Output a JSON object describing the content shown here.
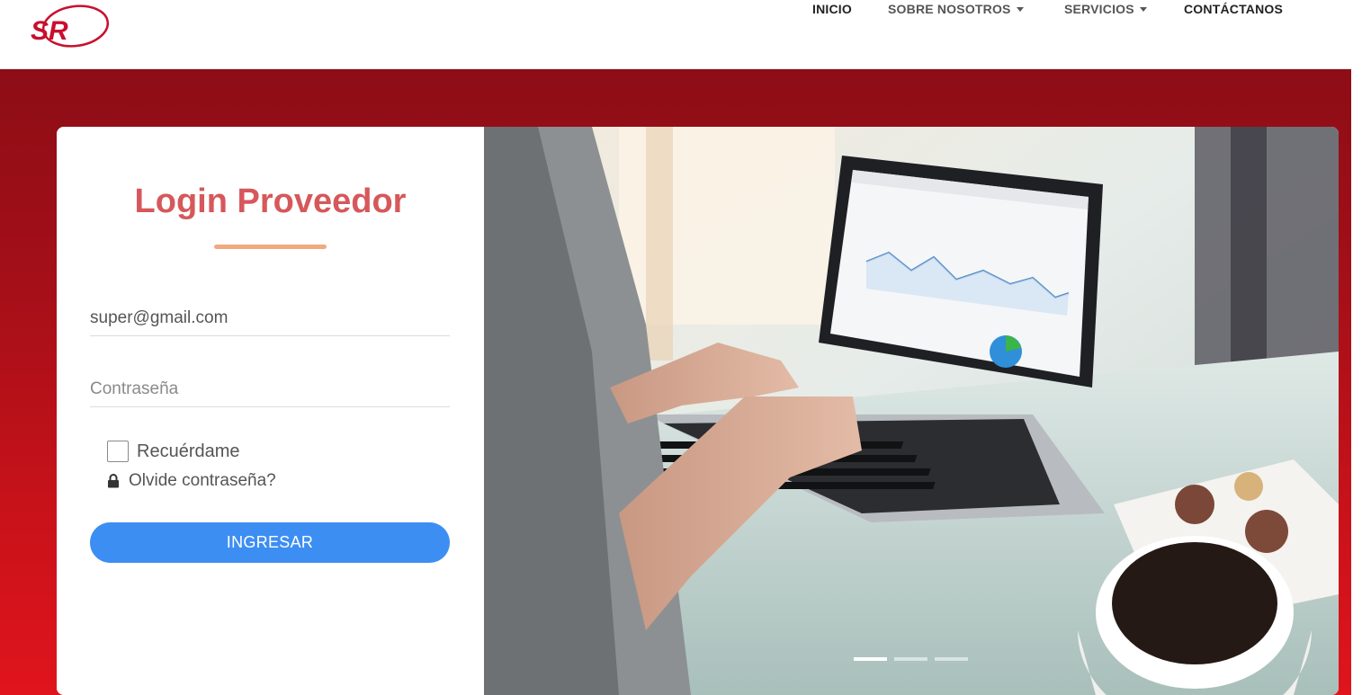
{
  "brand": {
    "logo_text": "SR",
    "logo_color": "#c8102e"
  },
  "nav": {
    "items": [
      {
        "label": "INICIO",
        "dropdown": false
      },
      {
        "label": "SOBRE NOSOTROS",
        "dropdown": true
      },
      {
        "label": "SERVICIOS",
        "dropdown": true
      },
      {
        "label": "CONTÁCTANOS",
        "dropdown": false
      }
    ]
  },
  "login": {
    "title": "Login Proveedor",
    "email_value": "super@gmail.com",
    "email_placeholder": "",
    "password_value": "",
    "password_placeholder": "Contraseña",
    "remember_label": "Recuérdame",
    "remember_checked": false,
    "forgot_label": "Olvide contraseña?",
    "submit_label": "INGRESAR"
  },
  "carousel": {
    "slide_count": 3,
    "active_slide": 1,
    "image_description_icon": "laptop-analytics-photo"
  },
  "colors": {
    "title": "#d6585b",
    "accent_bar": "#f1a97f",
    "button": "#3d8ef3",
    "hero_top": "#8d0d16",
    "hero_bottom": "#e0141c"
  }
}
